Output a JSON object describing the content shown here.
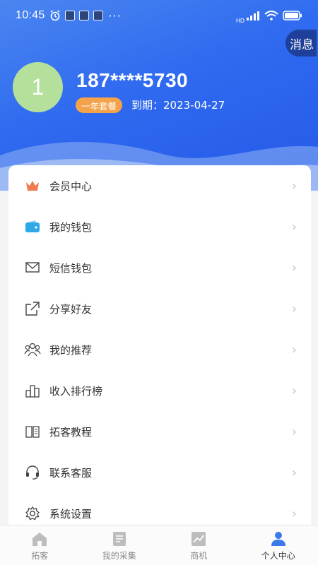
{
  "status_bar": {
    "time": "10:45",
    "network": "HD"
  },
  "header": {
    "message_label": "消息",
    "avatar_text": "1",
    "phone": "187****5730",
    "plan_badge": "一年套餐",
    "expire_text": "到期：2023-04-27"
  },
  "menu": {
    "items": [
      {
        "label": "会员中心",
        "icon": "crown-icon"
      },
      {
        "label": "我的钱包",
        "icon": "wallet-icon"
      },
      {
        "label": "短信钱包",
        "icon": "envelope-icon"
      },
      {
        "label": "分享好友",
        "icon": "share-icon"
      },
      {
        "label": "我的推荐",
        "icon": "people-icon"
      },
      {
        "label": "收入排行榜",
        "icon": "ranking-icon"
      },
      {
        "label": "拓客教程",
        "icon": "book-icon"
      },
      {
        "label": "联系客服",
        "icon": "headset-icon"
      },
      {
        "label": "系统设置",
        "icon": "gear-icon"
      }
    ],
    "arrow": "›"
  },
  "tabbar": {
    "tabs": [
      {
        "label": "拓客",
        "icon": "home-icon"
      },
      {
        "label": "我的采集",
        "icon": "document-icon"
      },
      {
        "label": "商机",
        "icon": "chart-icon"
      },
      {
        "label": "个人中心",
        "icon": "person-icon",
        "active": true
      }
    ]
  },
  "colors": {
    "header_blue": "#2f6af0",
    "badge_orange": "#f5a34a",
    "avatar_green": "#b4e09c",
    "crown_orange": "#f07a52",
    "wallet_blue": "#2fa8e8",
    "active_tab_blue": "#3a7be8"
  }
}
